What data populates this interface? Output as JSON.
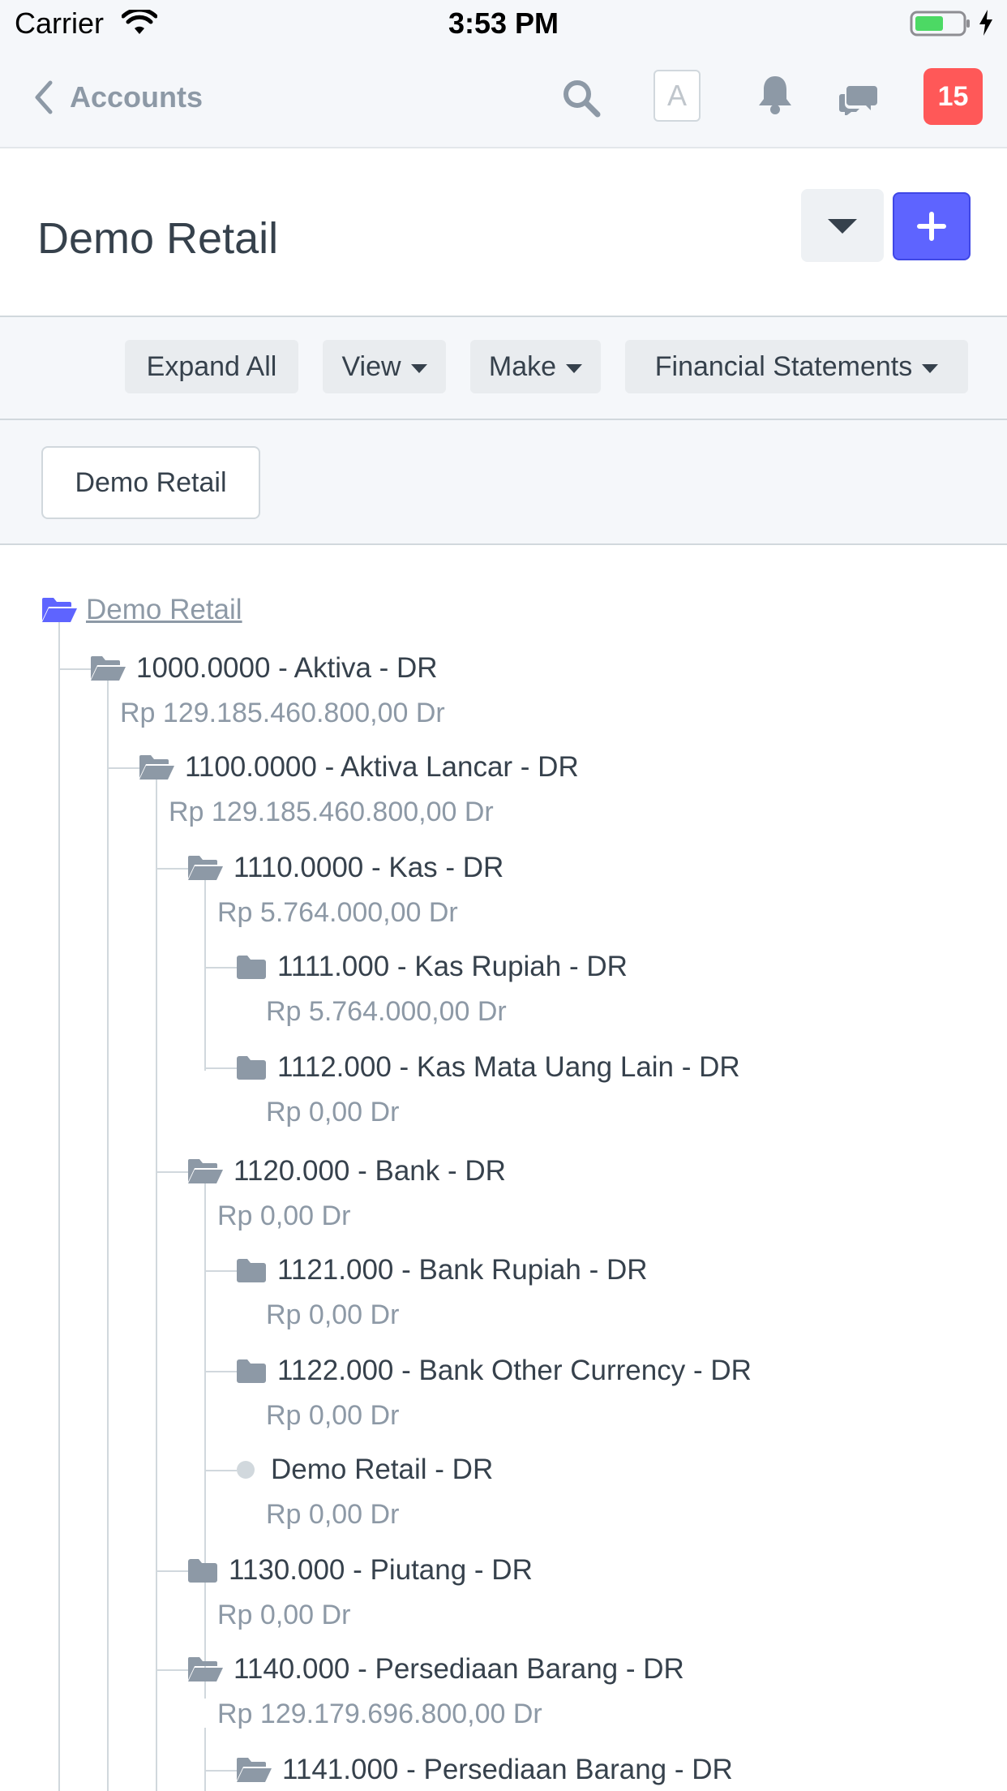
{
  "status_bar": {
    "carrier": "Carrier",
    "time": "3:53 PM",
    "battery_color": "#4cd964"
  },
  "navbar": {
    "back_label": "Accounts",
    "avatar_letter": "A",
    "notification_count": "15",
    "icons": [
      "search-icon",
      "bell-icon",
      "chat-icon"
    ]
  },
  "page": {
    "title": "Demo Retail",
    "accent_color": "#5e64ff"
  },
  "toolbar": {
    "expand_all": "Expand All",
    "view": "View",
    "make": "Make",
    "financial_statements": "Financial Statements"
  },
  "filter": {
    "company": "Demo Retail"
  },
  "tree": {
    "root": "Demo Retail",
    "nodes": [
      {
        "label": "1000.0000 - Aktiva - DR",
        "balance": "Rp 129.185.460.800,00 Dr",
        "icon": "folder-open-icon"
      },
      {
        "label": "1100.0000 - Aktiva Lancar - DR",
        "balance": "Rp 129.185.460.800,00 Dr",
        "icon": "folder-open-icon"
      },
      {
        "label": "1110.0000 - Kas - DR",
        "balance": "Rp 5.764.000,00 Dr",
        "icon": "folder-open-icon"
      },
      {
        "label": "1111.000 - Kas Rupiah - DR",
        "balance": "Rp 5.764.000,00 Dr",
        "icon": "folder-icon"
      },
      {
        "label": "1112.000 - Kas Mata Uang Lain - DR",
        "balance": "Rp 0,00 Dr",
        "icon": "folder-icon"
      },
      {
        "label": "1120.000 - Bank - DR",
        "balance": "Rp 0,00 Dr",
        "icon": "folder-open-icon"
      },
      {
        "label": "1121.000 - Bank Rupiah - DR",
        "balance": "Rp 0,00 Dr",
        "icon": "folder-icon"
      },
      {
        "label": "1122.000 - Bank Other Currency - DR",
        "balance": "Rp 0,00 Dr",
        "icon": "folder-icon"
      },
      {
        "label": "Demo Retail - DR",
        "balance": "Rp 0,00 Dr",
        "icon": "leaf-dot-icon"
      },
      {
        "label": "1130.000 - Piutang - DR",
        "balance": "Rp 0,00 Dr",
        "icon": "folder-icon"
      },
      {
        "label": "1140.000 - Persediaan Barang - DR",
        "balance": "Rp 129.179.696.800,00 Dr",
        "icon": "folder-open-icon"
      },
      {
        "label": "1141.000 - Persediaan Barang - DR",
        "balance": "",
        "icon": "folder-open-icon"
      }
    ]
  }
}
